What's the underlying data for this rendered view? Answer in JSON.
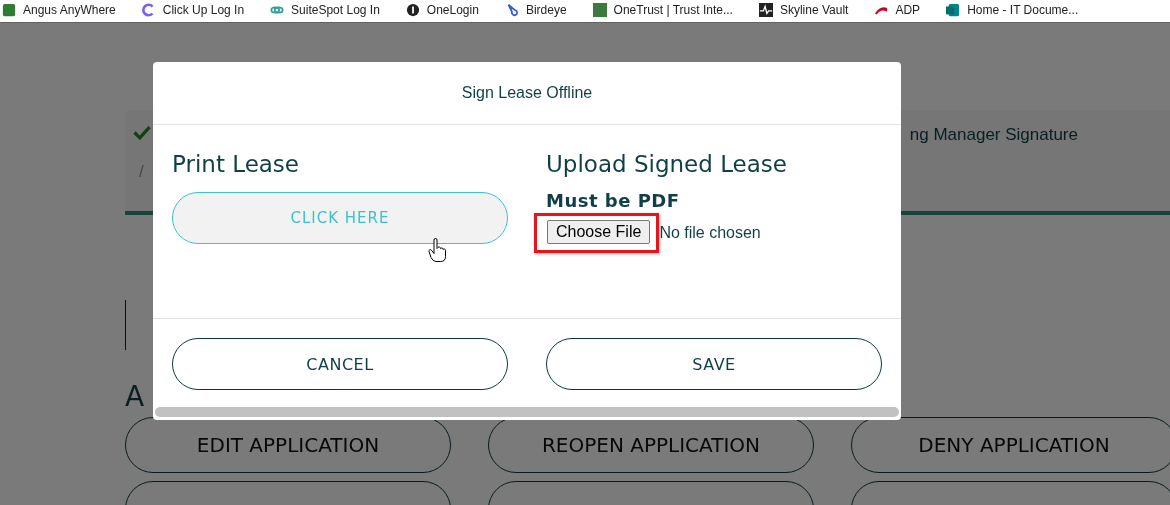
{
  "bookmarks": [
    {
      "label": "Angus AnyWhere"
    },
    {
      "label": "Click Up Log In"
    },
    {
      "label": "SuiteSpot Log In"
    },
    {
      "label": "OneLogin"
    },
    {
      "label": "Birdeye"
    },
    {
      "label": "OneTrust | Trust Inte..."
    },
    {
      "label": "Skyline Vault"
    },
    {
      "label": "ADP"
    },
    {
      "label": "Home - IT Docume..."
    }
  ],
  "page": {
    "steps": [
      {
        "completed": true,
        "note": "/"
      },
      {
        "completed": false,
        "label": "ng Manager Signature"
      }
    ],
    "section_heading": "A",
    "actions": [
      "EDIT APPLICATION",
      "REOPEN APPLICATION",
      "DENY APPLICATION"
    ]
  },
  "modal": {
    "title": "Sign Lease Offline",
    "print": {
      "heading": "Print Lease",
      "button": "CLICK HERE"
    },
    "upload": {
      "heading": "Upload Signed Lease",
      "note": "Must be PDF",
      "file_button": "Choose File",
      "file_status": "No file chosen",
      "highlighted": true
    },
    "buttons": [
      "CANCEL",
      "SAVE"
    ]
  }
}
